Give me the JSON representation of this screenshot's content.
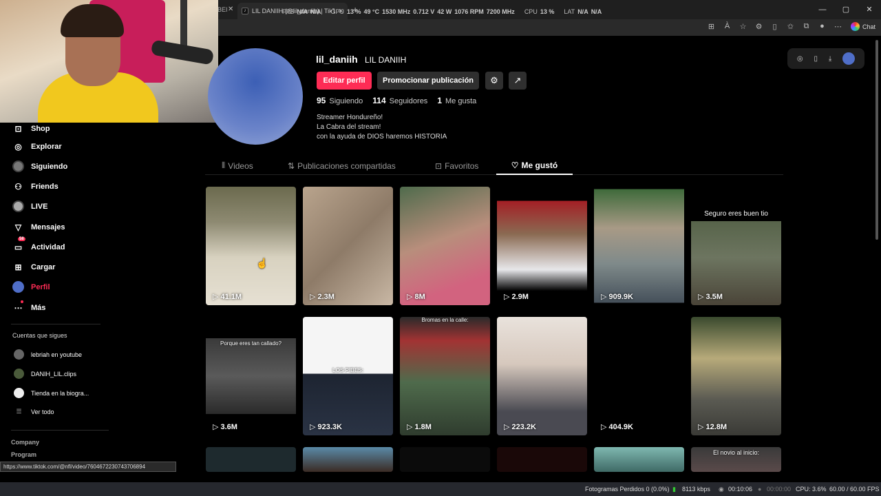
{
  "browser": {
    "prev_tab_fragment": "BEI",
    "prev_tab_close": "✕",
    "active_tab_title": "LIL DANIIH (@lil_daniih) | TikTok",
    "active_tab_close": "✕",
    "new_tab": "+",
    "window_buttons": [
      "—",
      "▢",
      "✕"
    ],
    "chat_label": "Chat",
    "address_icons": [
      "grid-icon",
      "translate-icon",
      "star-icon",
      "extension-icon",
      "split-icon",
      "favorites-icon",
      "collections-icon",
      "profile-icon",
      "more-icon"
    ],
    "address_glyphs": [
      "⊞",
      "À",
      "☆",
      "⚙",
      "▯",
      "✩",
      "⧉",
      "●",
      "⋯"
    ]
  },
  "osd": {
    "fps_label": "FPS",
    "fps_1": "N/A",
    "fps_2": "N/A",
    "gpu_label": "GPU",
    "gpu_load": "13 %",
    "gpu_temp": "49 °C",
    "gpu_clock": "1530 MHz",
    "gpu_volt": "0.712 V",
    "gpu_power": "42 W",
    "gpu_fan": "1076 RPM",
    "gpu_mem": "7200 MHz",
    "cpu_label": "CPU",
    "cpu_load": "13 %",
    "lat_label": "LAT",
    "lat_1": "N/A",
    "lat_2": "N/A"
  },
  "sidebar": {
    "items": [
      {
        "label": "Shop",
        "icon": "shop-icon",
        "glyph": "⊡"
      },
      {
        "label": "Explorar",
        "icon": "compass-icon",
        "glyph": "◎"
      },
      {
        "label": "Siguiendo",
        "icon": "following-avatar-icon",
        "glyph": ""
      },
      {
        "label": "Friends",
        "icon": "friends-icon",
        "glyph": "⚇"
      },
      {
        "label": "LIVE",
        "icon": "live-avatar-icon",
        "glyph": ""
      },
      {
        "label": "Mensajes",
        "icon": "messages-icon",
        "glyph": "▽"
      },
      {
        "label": "Actividad",
        "icon": "activity-icon",
        "glyph": "▭",
        "badge": "58"
      },
      {
        "label": "Cargar",
        "icon": "upload-icon",
        "glyph": "⊞"
      },
      {
        "label": "Perfil",
        "icon": "profile-avatar-icon",
        "glyph": ""
      },
      {
        "label": "Más",
        "icon": "more-icon",
        "glyph": "⋯"
      }
    ],
    "following_title": "Cuentas que sigues",
    "following": [
      {
        "label": "lebriah en youtube"
      },
      {
        "label": "DANIH_LIL.clips"
      },
      {
        "label": "Tienda en la biogra..."
      },
      {
        "label": "Ver todo"
      }
    ],
    "footer": [
      "Company",
      "Program"
    ]
  },
  "status_url": "https://www.tiktok.com/@nfl/video/7604672230743706894",
  "profile": {
    "username": "lil_daniih",
    "nickname": "LIL DANIIH",
    "edit_label": "Editar perfil",
    "promote_label": "Promocionar publicación",
    "settings_glyph": "⚙",
    "share_glyph": "↗",
    "following_count": "95",
    "following_label": "Siguiendo",
    "followers_count": "114",
    "followers_label": "Seguidores",
    "likes_count": "1",
    "likes_label": "Me gusta",
    "bio": [
      "Streamer Hondureño!",
      "La Cabra del stream!",
      "con la ayuda de DIOS haremos HISTORIA"
    ]
  },
  "tabs": [
    {
      "label": "Videos",
      "glyph": "⦀"
    },
    {
      "label": "Publicaciones compartidas",
      "glyph": "⇅"
    },
    {
      "label": "Favoritos",
      "glyph": "⊡"
    },
    {
      "label": "Me gustó",
      "glyph": "♡"
    }
  ],
  "videos": [
    {
      "views": "41.1M",
      "caption": ""
    },
    {
      "views": "2.3M",
      "caption": ""
    },
    {
      "views": "8M",
      "caption": ""
    },
    {
      "views": "2.9M",
      "caption": ""
    },
    {
      "views": "909.9K",
      "caption": ""
    },
    {
      "views": "3.5M",
      "caption": "Seguro eres buen tio"
    },
    {
      "views": "3.6M",
      "caption": "Porque eres tan callado?"
    },
    {
      "views": "923.3K",
      "caption": "LOS PIBES:"
    },
    {
      "views": "1.8M",
      "caption": "Bromas en la calle:"
    },
    {
      "views": "223.2K",
      "caption": ""
    },
    {
      "views": "404.9K",
      "caption": ""
    },
    {
      "views": "12.8M",
      "caption": ""
    },
    {
      "views": "",
      "caption": ""
    },
    {
      "views": "",
      "caption": ""
    },
    {
      "views": "",
      "caption": ""
    },
    {
      "views": "",
      "caption": ""
    },
    {
      "views": "",
      "caption": ""
    },
    {
      "views": "",
      "caption": "El novio al inicio:"
    }
  ],
  "obs": {
    "dropped": "Fotogramas Perdidos 0 (0.0%)",
    "bitrate": "8113 kbps",
    "rec_time": "00:10:06",
    "stream_time": "00:00:00",
    "cpu": "CPU: 3.6%",
    "fps": "60.00 / 60.00 FPS"
  }
}
